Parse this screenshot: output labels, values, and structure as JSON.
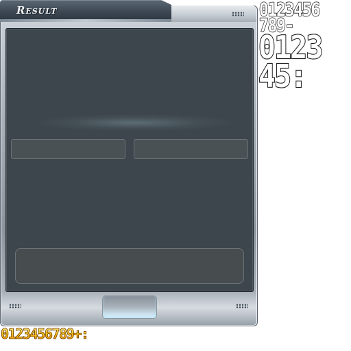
{
  "window": {
    "title": "Result"
  },
  "digit_sheets": {
    "outline_small_row1": "0123456",
    "outline_small_row2": "789-",
    "outline_large_row1": "0123",
    "outline_large_row2": "45:",
    "gold_row": "0123456789+:"
  },
  "colors": {
    "content_bg": "#3d464c",
    "frame_accent": "#a9b1b9",
    "gold_digits": "#f4b400"
  }
}
